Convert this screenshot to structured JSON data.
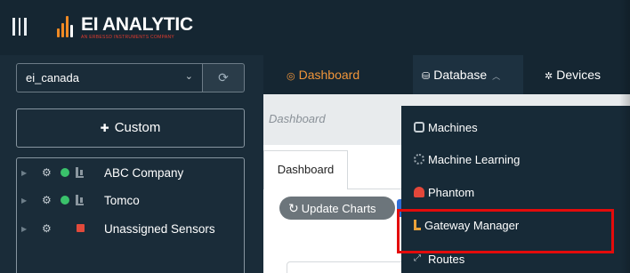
{
  "header": {
    "brand_name": "EI ANALYTIC",
    "brand_sub": "AN ERBESSD INSTRUMENTS COMPANY",
    "menu_icon": "hamburger-icon",
    "logo_icon": "analytic-bars-logo"
  },
  "sidebar": {
    "company": "ei_canada",
    "company_chevron": "chevron-down-icon",
    "refresh_icon": "refresh-icon",
    "custom_label": "Custom",
    "tree": [
      {
        "label": "ABC Company",
        "status_color": "#3ac26b"
      },
      {
        "label": "Tomco",
        "status_color": "#3ac26b"
      },
      {
        "label": "Unassigned Sensors"
      }
    ]
  },
  "nav": {
    "dashboard": "Dashboard",
    "database": "Database",
    "devices": "Devices"
  },
  "main": {
    "breadcrumb": "Dashboard",
    "tab": "Dashboard",
    "update_button": "Update Charts"
  },
  "database_menu": {
    "items": [
      {
        "label": "Machines",
        "icon": "machine-icon"
      },
      {
        "label": "Machine Learning",
        "icon": "brain-icon"
      },
      {
        "label": "Phantom",
        "icon": "phantom-icon"
      },
      {
        "label": "Gateway Manager",
        "icon": "gateway-icon"
      },
      {
        "label": "Routes",
        "icon": "routes-icon"
      }
    ],
    "highlighted": "Gateway Manager"
  },
  "colors": {
    "header_bg": "#152632",
    "sidebar_bg": "#1a2c39",
    "accent_orange": "#f0953a",
    "highlight_red": "#e40b0b",
    "status_green": "#3ac26b"
  }
}
